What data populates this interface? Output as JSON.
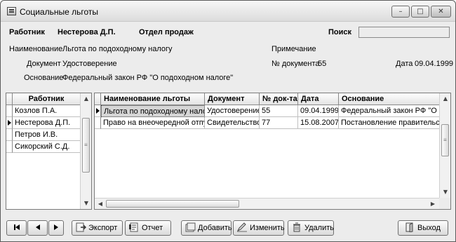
{
  "window": {
    "title": "Социальные льготы",
    "controls": {
      "minimize": "–",
      "maximize": "□",
      "close": "✕"
    }
  },
  "header": {
    "employee_label": "Работник",
    "employee_value": "Нестерова Д.П.",
    "department": "Отдел продаж",
    "search_label": "Поиск",
    "search_value": ""
  },
  "details": {
    "name_label": "Наименование",
    "name_value": "Льгота по подоходному налогу",
    "note_label": "Примечание",
    "note_value": "",
    "document_label": "Документ",
    "document_value": "Удостоверение",
    "doc_number_label": "№ документа",
    "doc_number_value": "55",
    "date_label": "Дата",
    "date_value": "09.04.1999",
    "basis_label": "Основание",
    "basis_value": "Федеральный закон РФ \"О подоходном налоге\""
  },
  "employees": {
    "header": "Работник",
    "rows": [
      "Козлов П.А.",
      "Нестерова Д.П.",
      "Петров И.В.",
      "Сикорский С.Д."
    ],
    "selected_index": 1
  },
  "benefits": {
    "columns": [
      "Наименование льготы",
      "Документ",
      "№ док-та",
      "Дата",
      "Основание"
    ],
    "rows": [
      [
        "Льгота по подоходному налогу",
        "Удостоверение",
        "55",
        "09.04.1999",
        "Федеральный закон РФ \"О подоходном налоге\""
      ],
      [
        "Право на внеочередной отпуск",
        "Свидетельство",
        "77",
        "15.08.2007",
        "Постановление правительства"
      ]
    ],
    "selected_index": 0
  },
  "toolbar": {
    "first": "",
    "prev": "",
    "next": "",
    "export": "Экспорт",
    "report": "Отчет",
    "add": "Добавить",
    "edit": "Изменить",
    "delete": "Удалить",
    "exit": "Выход"
  },
  "icons": {
    "app": "window-icon",
    "export": "export-icon",
    "report": "report-icon",
    "add": "add-icon",
    "edit": "edit-icon",
    "delete": "delete-icon",
    "exit": "exit-icon"
  }
}
